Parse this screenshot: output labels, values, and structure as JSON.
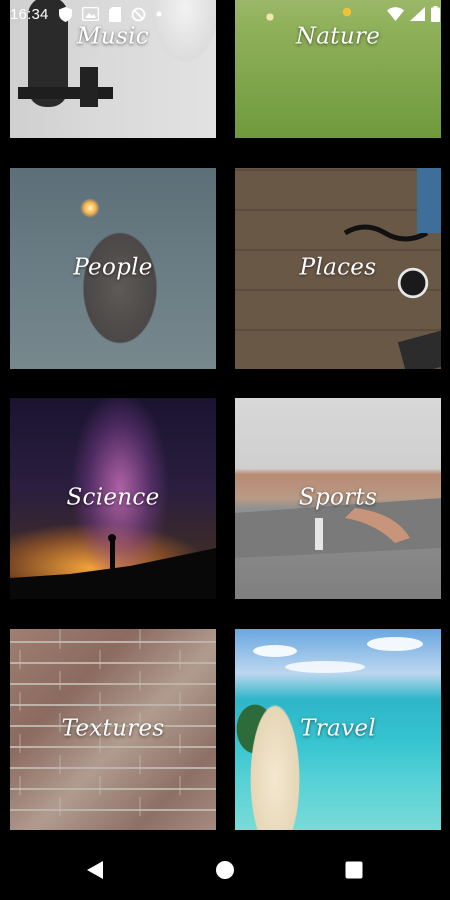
{
  "status_bar": {
    "time": "16:34",
    "left_icons": [
      "shield-icon",
      "image-icon",
      "sd-card-icon",
      "no-sync-icon",
      "dot-icon"
    ],
    "right_icons": [
      "wifi-icon",
      "signal-icon",
      "battery-icon"
    ]
  },
  "categories": [
    {
      "label": "Music"
    },
    {
      "label": "Nature"
    },
    {
      "label": "People"
    },
    {
      "label": "Places"
    },
    {
      "label": "Science"
    },
    {
      "label": "Sports"
    },
    {
      "label": "Textures"
    },
    {
      "label": "Travel"
    }
  ],
  "nav_bar": {
    "buttons": [
      "back-icon",
      "home-icon",
      "recents-icon"
    ]
  },
  "colors": {
    "background": "#000000",
    "text": "#ffffff"
  }
}
